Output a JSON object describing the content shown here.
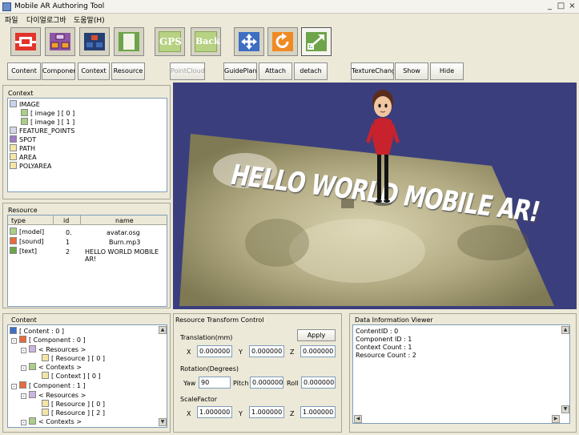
{
  "window": {
    "title": "Mobile AR Authoring Tool",
    "min": "_",
    "max": "□",
    "close": "×"
  },
  "menu": {
    "file": "파일",
    "dialog": "다이얼로그바",
    "help": "도움말(H)"
  },
  "toolbar": {
    "gps": "GPS",
    "back": "Back",
    "icons": [
      "frame-icon",
      "component-icon",
      "layout-icon",
      "panel-icon",
      "gps-icon",
      "back-icon",
      "move-icon",
      "rotate-icon",
      "scale-icon"
    ]
  },
  "buttons": {
    "content": "Content",
    "component": "Component",
    "context": "Context",
    "resource": "Resource",
    "pointcloud": "PointCloud",
    "guideplane": "GuidePlane",
    "attach": "Attach",
    "detach": "detach",
    "texturechange": "TextureChange",
    "show": "Show",
    "hide": "Hide"
  },
  "context_panel": {
    "title": "Context",
    "items": [
      "IMAGE",
      "[ image ] [ 0 ]",
      "[ image ] [ 1 ]",
      "FEATURE_POINTS",
      "SPOT",
      "PATH",
      "AREA",
      "POLYAREA"
    ]
  },
  "resource_panel": {
    "title": "Resource",
    "headers": {
      "type": "type",
      "id": "id",
      "name": "name"
    },
    "rows": [
      {
        "type": "[model]",
        "id": "0.",
        "name": "avatar.osg"
      },
      {
        "type": "[sound]",
        "id": "1",
        "name": "Burn.mp3"
      },
      {
        "type": "[text]",
        "id": "2",
        "name": "HELLO WORLD MOBILE AR!"
      }
    ]
  },
  "viewport": {
    "overlay_text": "HELLO WORLD MOBILE AR!"
  },
  "content_panel": {
    "title": "Content",
    "items": [
      "[ Content : 0 ]",
      "[ Component : 0 ]",
      "< Resources >",
      "[ Resource ] [ 0 ]",
      "< Contexts >",
      "[ Context ] [ 0 ]",
      "[ Component : 1 ]",
      "< Resources >",
      "[ Resource ] [ 0 ]",
      "[ Resource ] [ 2 ]",
      "< Contexts >"
    ]
  },
  "transform": {
    "title": "Resource Transform Control",
    "apply": "Apply",
    "translation_label": "Translation(mm)",
    "rotation_label": "Rotation(Degrees)",
    "scale_label": "ScaleFactor",
    "x": "X",
    "y": "Y",
    "z": "Z",
    "yaw": "Yaw",
    "pitch": "Pitch",
    "roll": "Roll",
    "tx": "0.000000",
    "ty": "0.000000",
    "tz": "0.000000",
    "ryaw": "90",
    "rpitch": "0.000000",
    "rroll": "0.000000",
    "sx": "1.000000",
    "sy": "1.000000",
    "sz": "1.000000"
  },
  "info": {
    "title": "Data Information Viewer",
    "lines": [
      "ContentID : 0",
      "Component ID : 1",
      "Context Count : 1",
      "Resource Count : 2"
    ]
  }
}
